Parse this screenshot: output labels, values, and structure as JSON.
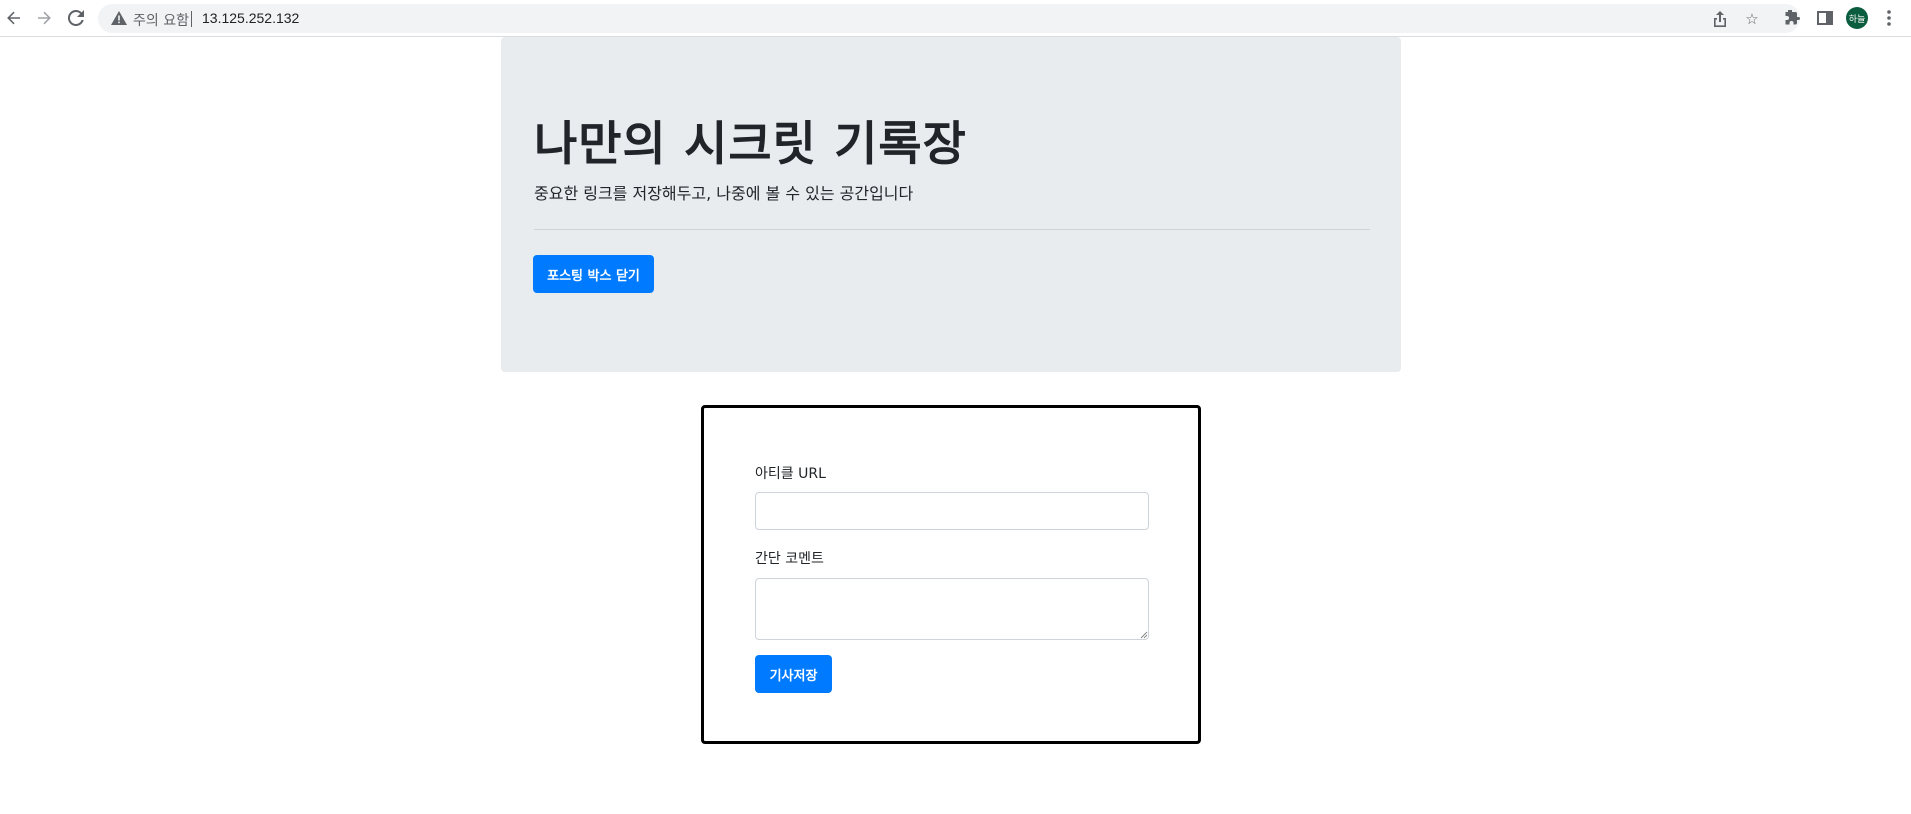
{
  "browser": {
    "security_label": "주의 요함",
    "url": "13.125.252.132",
    "profile_initials": "하늘",
    "icons": [
      "back-arrow-icon",
      "forward-arrow-icon",
      "reload-icon",
      "warning-icon",
      "share-icon",
      "star-icon",
      "extensions-icon",
      "side-panel-icon",
      "kebab-menu-icon"
    ]
  },
  "jumbotron": {
    "title": "나만의 시크릿 기록장",
    "lead": "중요한 링크를 저장해두고, 나중에 볼 수 있는 공간입니다",
    "toggle_button": "포스팅 박스 닫기"
  },
  "posting_box": {
    "url_label": "아티클 URL",
    "url_value": "",
    "comment_label": "간단 코멘트",
    "comment_value": "",
    "save_button": "기사저장"
  },
  "colors": {
    "primary": "#007bff",
    "jumbotron_bg": "#e9ecef",
    "border": "#000000"
  }
}
